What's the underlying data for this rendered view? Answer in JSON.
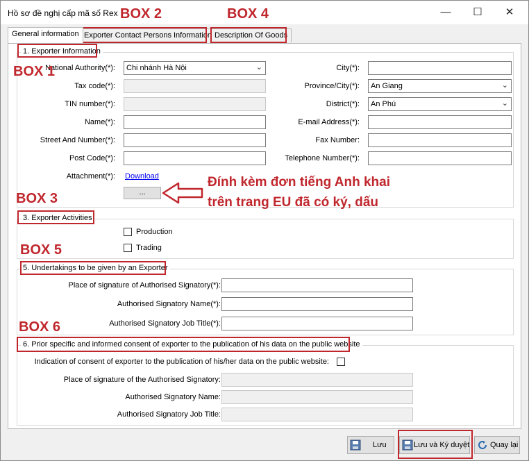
{
  "window": {
    "title": "Hồ sơ đề nghị cấp mã số Rex"
  },
  "tabs": [
    {
      "label": "General information"
    },
    {
      "label": "Exporter Contact Persons Information"
    },
    {
      "label": "Description Of Goods"
    }
  ],
  "section1": {
    "title": "1. Exporter Information",
    "national_authority_label": "National Authority(*):",
    "national_authority_value": "Chi nhánh Hà Nội",
    "tax_code_label": "Tax code(*):",
    "tin_number_label": "TIN number(*):",
    "name_label": "Name(*):",
    "street_label": "Street And Number(*):",
    "post_code_label": "Post Code(*):",
    "attachment_label": "Attachment(*):",
    "download_label": "Download",
    "browse_label": "...",
    "city_label": "City(*):",
    "province_label": "Province/City(*):",
    "province_value": "An Giang",
    "district_label": "District(*):",
    "district_value": "An Phú",
    "email_label": "E-mail Address(*):",
    "fax_label": "Fax Number:",
    "telephone_label": "Telephone Number(*):"
  },
  "section3": {
    "title": "3. Exporter Activities",
    "production_label": "Production",
    "trading_label": "Trading"
  },
  "section5": {
    "title": "5. Undertakings to be given by an Exporter",
    "place_label": "Place of signature of Authorised Signatory(*):",
    "name_label": "Authorised Signatory Name(*):",
    "job_label": "Authorised Signatory Job Title(*):"
  },
  "section6": {
    "title": "6. Prior specific and informed consent of exporter to the publication of his data on the public website",
    "consent_label": "Indication of consent of exporter to the publication of his/her data on the public website:",
    "place_label": "Place of signature of the Authorised Signatory:",
    "name_label": "Authorised Signatory Name:",
    "job_label": "Authorised Signatory Job Title:"
  },
  "buttons": {
    "save": "Lưu",
    "save_sign": "Lưu và Ký duyệt",
    "back": "Quay lại"
  },
  "annotations": {
    "box1": "BOX 1",
    "box2": "BOX 2",
    "box3": "BOX 3",
    "box4": "BOX 4",
    "box5": "BOX 5",
    "box6": "BOX 6",
    "note_line1": "Đính kèm đơn tiếng Anh khai",
    "note_line2": "trên trang EU đã có ký, dấu"
  },
  "colors": {
    "annotation": "#c0272d",
    "link": "#0000ee"
  }
}
